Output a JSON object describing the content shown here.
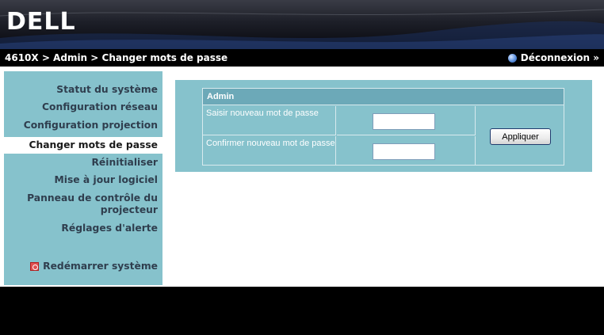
{
  "header": {
    "logo_text": "DELL"
  },
  "topbar": {
    "breadcrumb": "4610X > Admin > Changer mots de passe",
    "logout_label": "Déconnexion »"
  },
  "sidebar": {
    "items": [
      {
        "label": "Statut du système"
      },
      {
        "label": "Configuration réseau"
      },
      {
        "label": "Configuration projection"
      },
      {
        "label": "Changer mots de passe",
        "active": true
      },
      {
        "label": "Réinitialiser"
      },
      {
        "label": "Mise à jour logiciel"
      },
      {
        "label": "Panneau de contrôle du"
      },
      {
        "label": "projecteur"
      },
      {
        "label": "Réglages d'alerte"
      }
    ],
    "restart_label": "Redémarrer système"
  },
  "form": {
    "section_title": "Admin",
    "new_password_label": "Saisir nouveau mot de passe",
    "new_password_value": "",
    "confirm_password_label": "Confirmer nouveau mot de passe",
    "confirm_password_value": "",
    "apply_label": "Appliquer"
  },
  "colors": {
    "panel": "#86c2cc",
    "header_row": "#6ca9b8",
    "bar": "#000000"
  }
}
